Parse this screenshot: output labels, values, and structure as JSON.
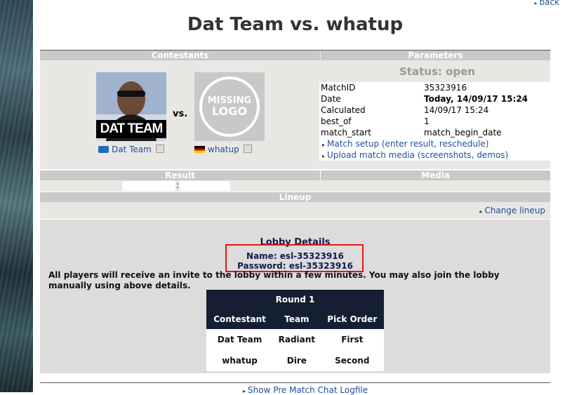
{
  "nav": {
    "back_label": "back"
  },
  "page": {
    "title": "Dat Team vs. whatup"
  },
  "headers": {
    "contestants": "Contestants",
    "parameters": "Parameters",
    "result": "Result",
    "media": "Media",
    "lineup": "Lineup"
  },
  "contestants": {
    "team1": {
      "name": "Dat Team",
      "logo_text": "DAT TEAM",
      "flag": "world-flag-icon"
    },
    "vs": "vs.",
    "team2": {
      "name": "whatup",
      "logo_line1": "MISSING",
      "logo_line2": "LOGO",
      "flag": "germany-flag-icon"
    }
  },
  "status": "Status: open",
  "parameters": [
    {
      "key": "MatchID",
      "value": "35323916",
      "bold": false
    },
    {
      "key": "Date",
      "value": "Today, 14/09/17 15:24",
      "bold": true
    },
    {
      "key": "Calculated",
      "value": "14/09/17 15:24",
      "bold": false
    },
    {
      "key": "best_of",
      "value": "1",
      "bold": false
    },
    {
      "key": "match_start",
      "value": "match_begin_date",
      "bold": false
    }
  ],
  "links": {
    "match_setup": "Match setup (enter result, reschedule)",
    "upload_media": "Upload match media (screenshots, demos)",
    "change_lineup": "Change lineup",
    "chat_log": "Show Pre Match Chat Logfile"
  },
  "result": {
    "separator": ":"
  },
  "lobby": {
    "title": "Lobby Details",
    "name_line": "Name: esl-35323916",
    "password_line": "Password: esl-35323916",
    "note": "All players will receive an invite to the lobby within a few minutes. You may also join the lobby manually using above details."
  },
  "round_table": {
    "caption": "Round 1",
    "columns": [
      "Contestant",
      "Team",
      "Pick Order"
    ],
    "rows": [
      [
        "Dat Team",
        "Radiant",
        "First"
      ],
      [
        "whatup",
        "Dire",
        "Second"
      ]
    ]
  },
  "colors": {
    "link": "#1f4f9b",
    "header_bg": "#c9c9c9",
    "table_header": "#151f33",
    "highlight_box": "#e01818"
  }
}
